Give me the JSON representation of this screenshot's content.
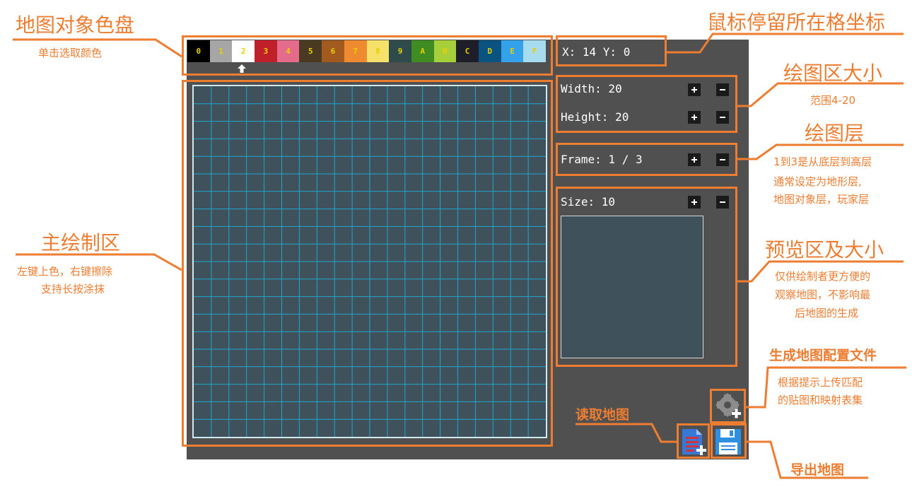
{
  "palette": {
    "swatches": [
      {
        "label": "0",
        "color": "#000000"
      },
      {
        "label": "1",
        "color": "#a6a6a6"
      },
      {
        "label": "2",
        "color": "#ffffff"
      },
      {
        "label": "3",
        "color": "#c0202a"
      },
      {
        "label": "4",
        "color": "#e56b8d"
      },
      {
        "label": "5",
        "color": "#4a3a22"
      },
      {
        "label": "6",
        "color": "#a35a1e"
      },
      {
        "label": "7",
        "color": "#ee8a30"
      },
      {
        "label": "8",
        "color": "#f6e26a"
      },
      {
        "label": "9",
        "color": "#2e4a4a"
      },
      {
        "label": "A",
        "color": "#3f8c22"
      },
      {
        "label": "B",
        "color": "#a6cf3a"
      },
      {
        "label": "C",
        "color": "#1e1e2a"
      },
      {
        "label": "D",
        "color": "#0a5280"
      },
      {
        "label": "E",
        "color": "#34a2ea"
      },
      {
        "label": "F",
        "color": "#a7dcf0"
      }
    ],
    "selected_index": 2
  },
  "coords": {
    "text": "X: 14  Y: 0"
  },
  "canvas_size": {
    "width_label": "Width: 20",
    "height_label": "Height: 20"
  },
  "frame": {
    "label": "Frame: 1 / 3"
  },
  "preview": {
    "size_label": "Size: 10"
  },
  "grid": {
    "cols": 20,
    "rows": 20
  },
  "colors": {
    "accent": "#ed7d31",
    "app_bg": "#505050",
    "grid_bg": "#3f525b",
    "grid_line": "#1fa6cc"
  },
  "annotations": {
    "palette_title": "地图对象色盘",
    "palette_desc": "单击选取颜色",
    "coords_title": "鼠标停留所在格坐标",
    "size_title": "绘图区大小",
    "size_desc": "范围4-20",
    "layer_title": "绘图层",
    "layer_desc": [
      "1到3是从底层到高层",
      "通常设定为地形层,",
      "地图对象层，玩家层"
    ],
    "draw_title": "主绘制区",
    "draw_desc": [
      "左键上色，右键擦除",
      "支持长按涂抹"
    ],
    "preview_title": "预览区及大小",
    "preview_desc": [
      "仅供绘制者更方便的",
      "观察地图，不影响最",
      "后地图的生成"
    ],
    "generate_title": "生成地图配置文件",
    "generate_desc": [
      "根据提示上传匹配",
      "的贴图和映射表集"
    ],
    "load_title": "读取地图",
    "export_title": "导出地图"
  },
  "icons": {
    "select_arrow": "up-arrow-icon",
    "plus": "plus-icon",
    "minus": "minus-icon",
    "generate": "gear-add-icon",
    "load": "document-add-icon",
    "export": "save-icon"
  }
}
